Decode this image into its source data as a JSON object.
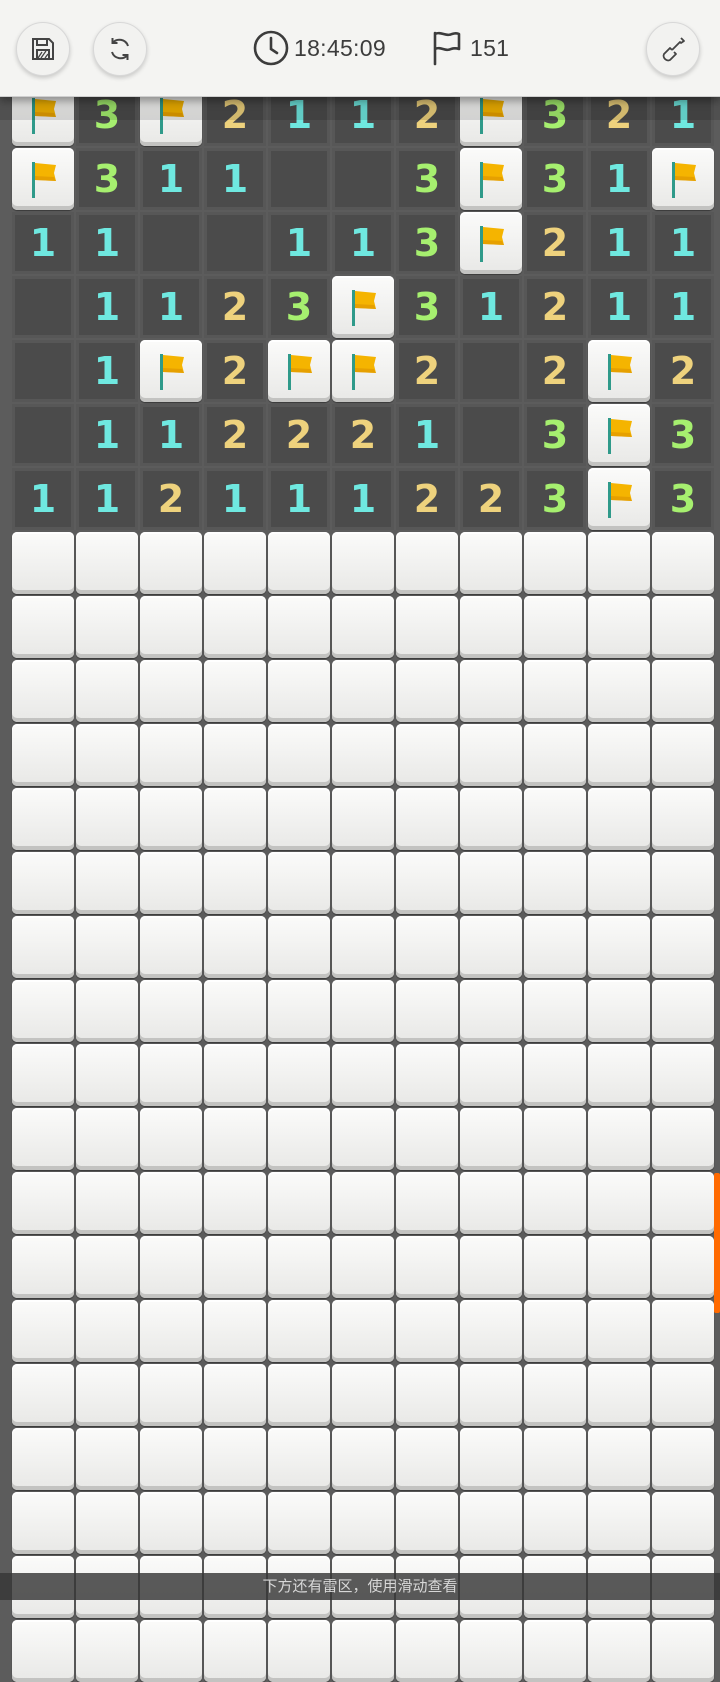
{
  "header": {
    "timer": "18:45:09",
    "flags_remaining": "151",
    "icons": {
      "save": "save-icon",
      "restart": "refresh-icon",
      "timer": "clock-icon",
      "flags": "flag-outline-icon",
      "tool": "shovel-icon"
    }
  },
  "board": {
    "columns": 11,
    "rows": [
      [
        "F",
        "3",
        "F",
        "2",
        "1",
        "1",
        "2",
        "F",
        "3",
        "2",
        "1"
      ],
      [
        "F",
        "3",
        "1",
        "1",
        "0",
        "0",
        "3",
        "F",
        "3",
        "1",
        "F"
      ],
      [
        "1",
        "1",
        "0",
        "0",
        "1",
        "1",
        "3",
        "F",
        "2",
        "1",
        "1"
      ],
      [
        "0",
        "1",
        "1",
        "2",
        "3",
        "F",
        "3",
        "1",
        "2",
        "1",
        "1"
      ],
      [
        "0",
        "1",
        "F",
        "2",
        "F",
        "F",
        "2",
        "0",
        "2",
        "F",
        "2"
      ],
      [
        "0",
        "1",
        "1",
        "2",
        "2",
        "2",
        "1",
        "0",
        "3",
        "F",
        "3"
      ],
      [
        "1",
        "1",
        "2",
        "1",
        "1",
        "1",
        "2",
        "2",
        "3",
        "F",
        "3"
      ],
      [
        "C",
        "C",
        "C",
        "C",
        "C",
        "C",
        "C",
        "C",
        "C",
        "C",
        "C"
      ],
      [
        "C",
        "C",
        "C",
        "C",
        "C",
        "C",
        "C",
        "C",
        "C",
        "C",
        "C"
      ],
      [
        "C",
        "C",
        "C",
        "C",
        "C",
        "C",
        "C",
        "C",
        "C",
        "C",
        "C"
      ],
      [
        "C",
        "C",
        "C",
        "C",
        "C",
        "C",
        "C",
        "C",
        "C",
        "C",
        "C"
      ],
      [
        "C",
        "C",
        "C",
        "C",
        "C",
        "C",
        "C",
        "C",
        "C",
        "C",
        "C"
      ],
      [
        "C",
        "C",
        "C",
        "C",
        "C",
        "C",
        "C",
        "C",
        "C",
        "C",
        "C"
      ],
      [
        "C",
        "C",
        "C",
        "C",
        "C",
        "C",
        "C",
        "C",
        "C",
        "C",
        "C"
      ],
      [
        "C",
        "C",
        "C",
        "C",
        "C",
        "C",
        "C",
        "C",
        "C",
        "C",
        "C"
      ],
      [
        "C",
        "C",
        "C",
        "C",
        "C",
        "C",
        "C",
        "C",
        "C",
        "C",
        "C"
      ],
      [
        "C",
        "C",
        "C",
        "C",
        "C",
        "C",
        "C",
        "C",
        "C",
        "C",
        "C"
      ],
      [
        "C",
        "C",
        "C",
        "C",
        "C",
        "C",
        "C",
        "C",
        "C",
        "C",
        "C"
      ],
      [
        "C",
        "C",
        "C",
        "C",
        "C",
        "C",
        "C",
        "C",
        "C",
        "C",
        "C"
      ],
      [
        "C",
        "C",
        "C",
        "C",
        "C",
        "C",
        "C",
        "C",
        "C",
        "C",
        "C"
      ],
      [
        "C",
        "C",
        "C",
        "C",
        "C",
        "C",
        "C",
        "C",
        "C",
        "C",
        "C"
      ],
      [
        "C",
        "C",
        "C",
        "C",
        "C",
        "C",
        "C",
        "C",
        "C",
        "C",
        "C"
      ],
      [
        "C",
        "C",
        "C",
        "C",
        "C",
        "C",
        "C",
        "C",
        "C",
        "C",
        "C"
      ],
      [
        "C",
        "C",
        "C",
        "C",
        "C",
        "C",
        "C",
        "C",
        "C",
        "C",
        "C"
      ],
      [
        "C",
        "C",
        "C",
        "C",
        "C",
        "C",
        "C",
        "C",
        "C",
        "C",
        "C"
      ]
    ],
    "legend": {
      "F": "flag",
      "C": "covered",
      "0": "empty"
    },
    "number_colors": {
      "1": "#6fe8e0",
      "2": "#eed27d",
      "3": "#a6ef6f"
    },
    "flag_color": "#f5b400"
  },
  "footer": {
    "hint": "下方还有雷区，使用滑动查看"
  },
  "colors": {
    "header_bg": "#f4f4f2",
    "board_bg": "#5c5c5c",
    "scroll_accent": "#ff6a00"
  }
}
